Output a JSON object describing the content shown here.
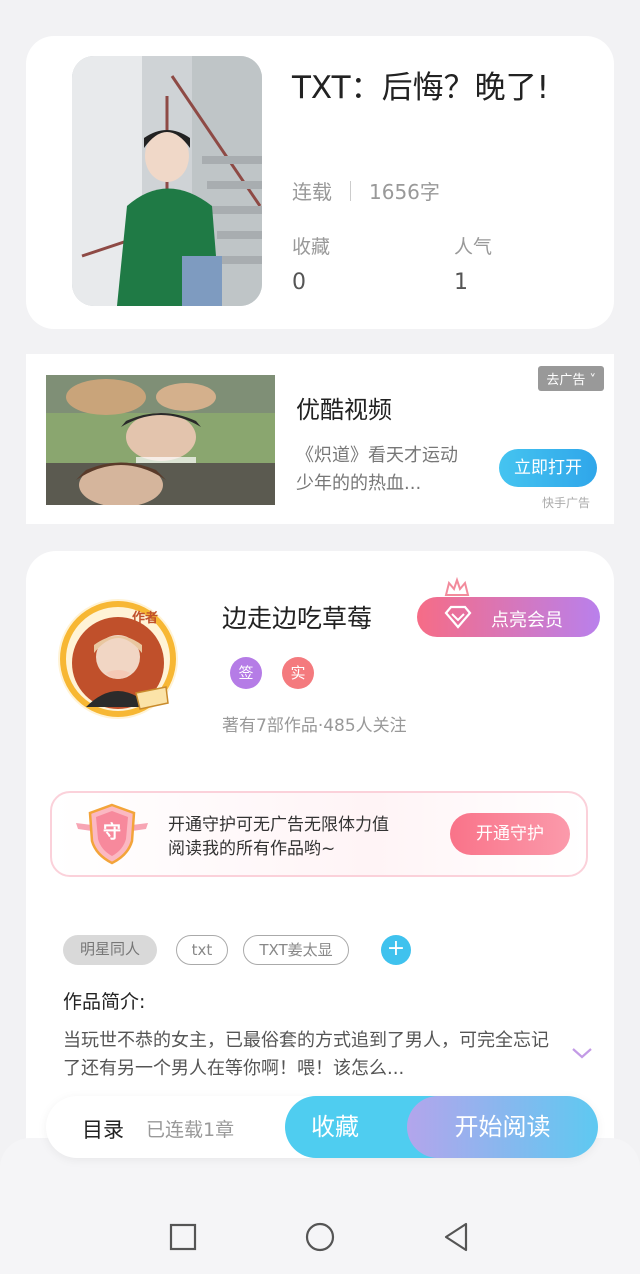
{
  "book": {
    "title": "TXT：后悔？晚了!",
    "status": "连载",
    "word_count": "1656字",
    "collect_label": "收藏",
    "collect_value": "0",
    "popularity_label": "人气",
    "popularity_value": "1"
  },
  "ad": {
    "close_label": "去广告 ˅",
    "title": "优酷视频",
    "description": "《炽道》看天才运动少年的的热血...",
    "open_button": "立即打开",
    "source": "快手广告"
  },
  "author": {
    "avatar_badge": "作者",
    "name": "边走边吃草莓",
    "vip_button": "点亮会员",
    "badge_signed": "签",
    "badge_verified": "实",
    "meta": "著有7部作品·485人关注"
  },
  "guard": {
    "icon_char": "守",
    "line1": "开通守护可无广告无限体力值",
    "line2": "阅读我的所有作品哟~",
    "button": "开通守护"
  },
  "tags": {
    "items": [
      "明星同人",
      "txt",
      "TXT姜太显"
    ],
    "add": "+"
  },
  "intro": {
    "title": "作品简介:",
    "text": "当玩世不恭的女主，已最俗套的方式追到了男人，可完全忘记了还有另一个男人在等你啊！喂！该怎么..."
  },
  "bottom_bar": {
    "toc_label": "目录",
    "toc_sub": "已连载1章",
    "collect_button": "收藏",
    "read_button": "开始阅读"
  },
  "colors": {
    "accent_blue": "#4fcdf0",
    "vip_pink": "#f66c86",
    "vip_purple": "#b980ec",
    "guard_pink": "#f97389"
  }
}
